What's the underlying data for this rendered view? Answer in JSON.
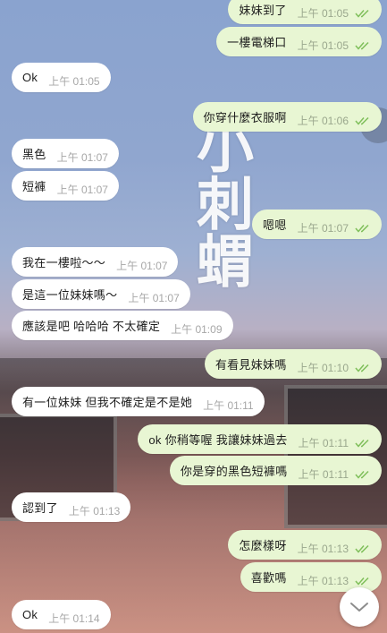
{
  "chat": {
    "messages": [
      {
        "dir": "out",
        "text": "妹妹到了",
        "time": "上午 01:05"
      },
      {
        "dir": "out",
        "text": "一樓電梯口",
        "time": "上午 01:05"
      },
      {
        "dir": "in",
        "text": "Ok",
        "time": "上午 01:05"
      },
      {
        "dir": "out",
        "text": "你穿什麼衣服啊",
        "time": "上午 01:06"
      },
      {
        "dir": "in",
        "text": "黑色",
        "time": "上午 01:07"
      },
      {
        "dir": "in",
        "text": "短褲",
        "time": "上午 01:07"
      },
      {
        "dir": "out",
        "text": "嗯嗯",
        "time": "上午 01:07"
      },
      {
        "dir": "in",
        "text": "我在一樓啦～～",
        "time": "上午 01:07"
      },
      {
        "dir": "in",
        "text": "是這一位妹妹嗎～",
        "time": "上午 01:07"
      },
      {
        "dir": "in",
        "text": "應該是吧 哈哈哈 不太確定",
        "time": "上午 01:09"
      },
      {
        "dir": "out",
        "text": "有看見妹妹嗎",
        "time": "上午 01:10"
      },
      {
        "dir": "in",
        "text": "有一位妹妹 但我不確定是不是她",
        "time": "上午 01:11"
      },
      {
        "dir": "out",
        "text": "ok 你稍等喔  我讓妹妹過去",
        "time": "上午 01:11"
      },
      {
        "dir": "out",
        "text": "你是穿的黑色短褲嗎",
        "time": "上午 01:11"
      },
      {
        "dir": "in",
        "text": "認到了",
        "time": "上午 01:13"
      },
      {
        "dir": "out",
        "text": "怎麼樣呀",
        "time": "上午 01:13"
      },
      {
        "dir": "out",
        "text": "喜歡嗎",
        "time": "上午 01:13"
      },
      {
        "dir": "in",
        "text": "Ok",
        "time": "上午 01:14"
      }
    ]
  },
  "background": {
    "overlay_text": "小刺蝟"
  },
  "icons": {
    "read_receipt": "double-check-icon",
    "scroll_down": "chevron-down-icon"
  },
  "colors": {
    "incoming_bubble": "#ffffff",
    "outgoing_bubble": "#e8f6d3",
    "read_check": "#7fbf5a",
    "timestamp": "#a7a7a7"
  }
}
